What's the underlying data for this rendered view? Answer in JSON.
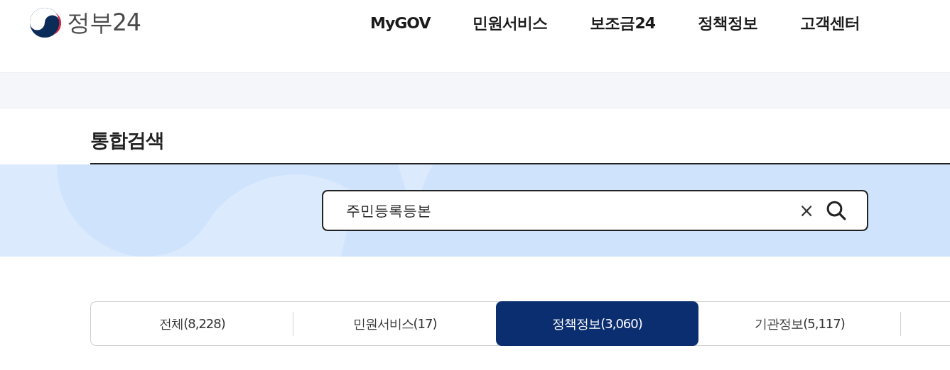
{
  "header": {
    "logo_text": "정부24",
    "nav": [
      {
        "label": "MyGOV"
      },
      {
        "label": "민원서비스"
      },
      {
        "label": "보조금24"
      },
      {
        "label": "정책정보"
      },
      {
        "label": "고객센터"
      }
    ]
  },
  "page_title": "통합검색",
  "search": {
    "value": "주민등록등본",
    "clear": "×"
  },
  "tabs": [
    {
      "label": "전체(8,228)",
      "selected": false
    },
    {
      "label": "민원서비스(17)",
      "selected": false
    },
    {
      "label": "정책정보(3,060)",
      "selected": true
    },
    {
      "label": "기관정보(5,117)",
      "selected": false
    }
  ]
}
